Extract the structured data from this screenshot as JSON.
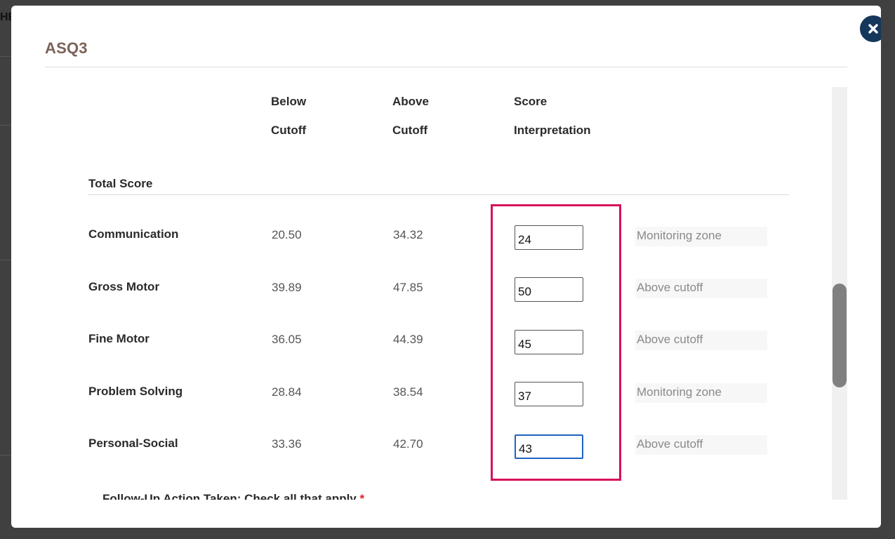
{
  "background": {
    "partial_text": "HE"
  },
  "modal": {
    "title": "ASQ3",
    "close_icon": "close-icon"
  },
  "table": {
    "headers": {
      "below_cutoff": [
        "Below",
        "Cutoff"
      ],
      "above_cutoff": [
        "Above",
        "Cutoff"
      ],
      "score_interpretation": [
        "Score",
        "Interpretation"
      ]
    },
    "section_title": "Total Score",
    "rows": [
      {
        "label": "Communication",
        "below": "20.50",
        "above": "34.32",
        "score": "24",
        "interpretation": "Monitoring zone"
      },
      {
        "label": "Gross Motor",
        "below": "39.89",
        "above": "47.85",
        "score": "50",
        "interpretation": "Above cutoff"
      },
      {
        "label": "Fine Motor",
        "below": "36.05",
        "above": "44.39",
        "score": "45",
        "interpretation": "Above cutoff"
      },
      {
        "label": "Problem Solving",
        "below": "28.84",
        "above": "38.54",
        "score": "37",
        "interpretation": "Monitoring zone"
      },
      {
        "label": "Personal-Social",
        "below": "33.36",
        "above": "42.70",
        "score": "43",
        "interpretation": "Above cutoff"
      }
    ]
  },
  "follow_up": {
    "text": "Follow-Up Action Taken: Check all that apply",
    "required": "*"
  },
  "colors": {
    "title": "#7a6258",
    "close_button": "#16375c",
    "highlight": "#d6115c",
    "focus": "#1f63c2"
  }
}
